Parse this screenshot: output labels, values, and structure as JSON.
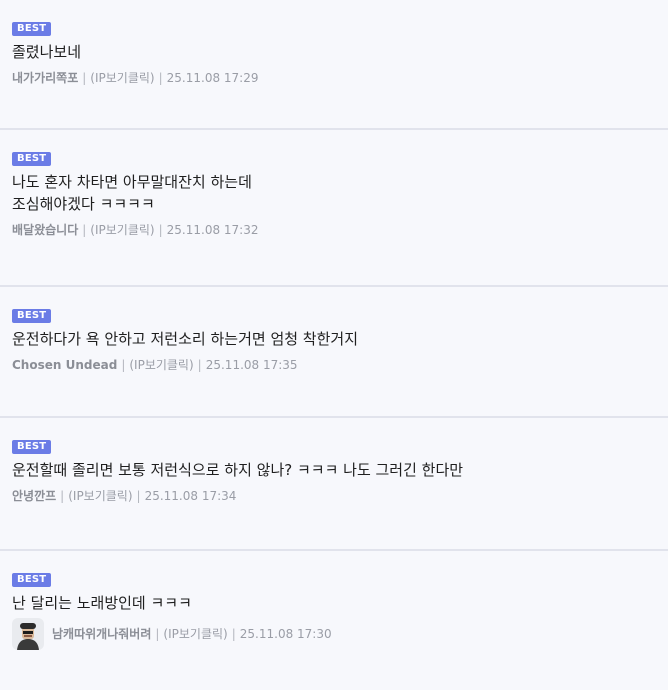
{
  "badge_label": "BEST",
  "separator": "|",
  "comments": [
    {
      "lines": [
        "졸렸나보네"
      ],
      "author": "내가가리쪽포",
      "ip": "(IP보기클릭)",
      "date": "25.11.08 17:29"
    },
    {
      "lines": [
        "나도 혼자 차타면 아무말대잔치 하는데",
        "조심해야겠다 ㅋㅋㅋㅋ"
      ],
      "author": "배달왔습니다",
      "ip": "(IP보기클릭)",
      "date": "25.11.08 17:32"
    },
    {
      "lines": [
        "운전하다가 욕 안하고 저런소리 하는거면 엄청 착한거지"
      ],
      "author": "Chosen Undead",
      "ip": "(IP보기클릭)",
      "date": "25.11.08 17:35"
    },
    {
      "lines": [
        "운전할때 졸리면 보통 저런식으로 하지 않나? ㅋㅋㅋ 나도 그러긴 한다만"
      ],
      "author": "안녕깐프",
      "ip": "(IP보기클릭)",
      "date": "25.11.08 17:34"
    },
    {
      "lines": [
        "난 달리는 노래방인데 ㅋㅋㅋ"
      ],
      "author": "남캐따위개나줘버려",
      "ip": "(IP보기클릭)",
      "date": "25.11.08 17:30",
      "avatar": "user-avatar"
    }
  ]
}
